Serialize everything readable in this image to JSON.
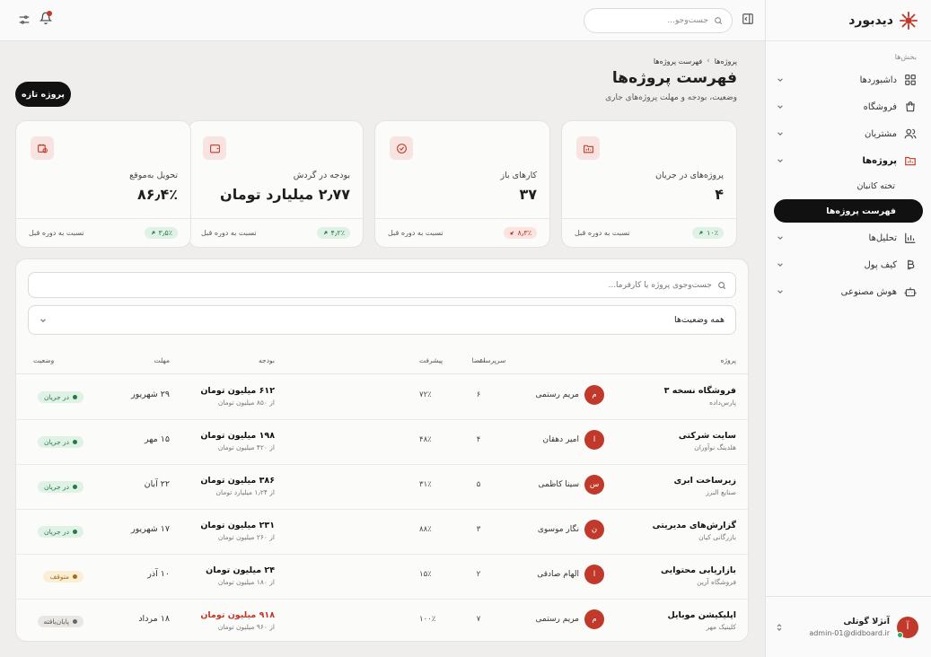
{
  "app": {
    "name": "دیدبورد"
  },
  "sidebar": {
    "section_label": "بخش‌ها",
    "items": [
      {
        "label": "داشبوردها",
        "icon": "dashboard-icon"
      },
      {
        "label": "فروشگاه",
        "icon": "shopping-bag-icon"
      },
      {
        "label": "مشتریان",
        "icon": "users-icon"
      },
      {
        "label": "پروژه‌ها",
        "icon": "folder-chart-icon"
      },
      {
        "label": "تحلیل‌ها",
        "icon": "bar-chart-icon"
      },
      {
        "label": "کیف پول",
        "icon": "bitcoin-icon"
      },
      {
        "label": "هوش مصنوعی",
        "icon": "robot-icon"
      }
    ],
    "sub_items": [
      {
        "label": "تخته کانبان"
      },
      {
        "label": "فهرست پروژه‌ها"
      }
    ],
    "user": {
      "initial": "آ",
      "name": "آنژلا گوتلی",
      "email": "admin-01@didboard.ir"
    }
  },
  "topbar": {
    "search_placeholder": "جست‌وجو..."
  },
  "header": {
    "breadcrumb": [
      "پروژه‌ها",
      "فهرست پروژه‌ها"
    ],
    "title": "فهرست پروژه‌ها",
    "subtitle": "وضعیت، بودجه و مهلت پروژه‌های جاری",
    "new_button": "پروژه تازه"
  },
  "stats": [
    {
      "label": "پروژه‌های در جریان",
      "value": "۴",
      "change": "۱۰٪",
      "direction": "up",
      "compare": "نسبت به دوره قبل",
      "icon": "folder-chart-icon"
    },
    {
      "label": "کارهای باز",
      "value": "۳۷",
      "change": "۸٫۳٪",
      "direction": "down",
      "compare": "نسبت به دوره قبل",
      "icon": "check-circle-icon"
    },
    {
      "label": "بودجه در گردش",
      "value": "۲٫۷۷ میلیارد تومان",
      "change": "۴٫۲٪",
      "direction": "up",
      "compare": "نسبت به دوره قبل",
      "icon": "wallet-icon"
    },
    {
      "label": "تحویل به‌موقع",
      "value": "۸۶٫۴٪",
      "change": "۳٫۵٪",
      "direction": "up",
      "compare": "نسبت به دوره قبل",
      "icon": "calendar-clock-icon"
    }
  ],
  "table": {
    "search_placeholder": "جست‌وجوی پروژه یا کارفرما...",
    "filter_value": "همه وضعیت‌ها",
    "columns": {
      "project": "پروژه",
      "lead": "سرپرست",
      "members": "اعضا",
      "progress": "پیشرفت",
      "budget": "بودجه",
      "deadline": "مهلت",
      "status": "وضعیت"
    },
    "rows": [
      {
        "name": "فروشگاه نسخه ۳",
        "client": "پارس‌داده",
        "lead_initial": "م",
        "lead": "مریم رستمی",
        "members": "۶",
        "progress": "۷۲٪",
        "budget": "۶۱۲ میلیون تومان",
        "budget_of": "از ۸۵۰ میلیون تومان",
        "deadline": "۲۹ شهریور",
        "status": "در جریان",
        "status_type": "active",
        "over_budget": false
      },
      {
        "name": "سایت شرکتی",
        "client": "هلدینگ نوآوران",
        "lead_initial": "ا",
        "lead": "امیر دهقان",
        "members": "۴",
        "progress": "۴۸٪",
        "budget": "۱۹۸ میلیون تومان",
        "budget_of": "از ۴۲۰ میلیون تومان",
        "deadline": "۱۵ مهر",
        "status": "در جریان",
        "status_type": "active",
        "over_budget": false
      },
      {
        "name": "زیرساخت ابری",
        "client": "صنایع البرز",
        "lead_initial": "س",
        "lead": "سینا کاظمی",
        "members": "۵",
        "progress": "۳۱٪",
        "budget": "۳۸۶ میلیون تومان",
        "budget_of": "از ۱٫۲۴ میلیارد تومان",
        "deadline": "۲۲ آبان",
        "status": "در جریان",
        "status_type": "active",
        "over_budget": false
      },
      {
        "name": "گزارش‌های مدیریتی",
        "client": "بازرگانی کیان",
        "lead_initial": "ن",
        "lead": "نگار موسوی",
        "members": "۳",
        "progress": "۸۸٪",
        "budget": "۲۳۱ میلیون تومان",
        "budget_of": "از ۲۶۰ میلیون تومان",
        "deadline": "۱۷ شهریور",
        "status": "در جریان",
        "status_type": "active",
        "over_budget": false
      },
      {
        "name": "بازاریابی محتوایی",
        "client": "فروشگاه آرین",
        "lead_initial": "ا",
        "lead": "الهام صادقی",
        "members": "۲",
        "progress": "۱۵٪",
        "budget": "۲۴ میلیون تومان",
        "budget_of": "از ۱۸۰ میلیون تومان",
        "deadline": "۱۰ آذر",
        "status": "متوقف",
        "status_type": "paused",
        "over_budget": false
      },
      {
        "name": "اپلیکیشن موبایل",
        "client": "کلینیک مهر",
        "lead_initial": "م",
        "lead": "مریم رستمی",
        "members": "۷",
        "progress": "۱۰۰٪",
        "budget": "۹۱۸ میلیون تومان",
        "budget_of": "از ۹۶۰ میلیون تومان",
        "deadline": "۱۸ مرداد",
        "status": "پایان‌یافته",
        "status_type": "done",
        "over_budget": true
      }
    ]
  }
}
